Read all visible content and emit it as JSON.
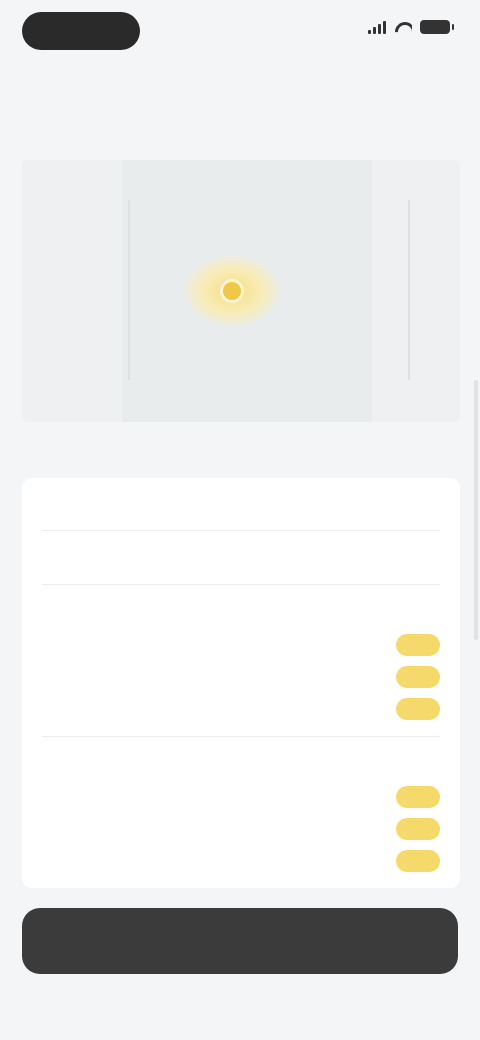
{
  "status_bar": {
    "time": "",
    "signal_icon": "signal-icon",
    "wifi_icon": "wifi-icon",
    "battery_icon": "battery-icon"
  },
  "header": {
    "title": ""
  },
  "section": {
    "title": ""
  },
  "preview": {
    "marker_icon": "location-marker-icon",
    "marker_label": "",
    "accent_color": "#efc84a"
  },
  "list": {
    "rows": [
      {
        "label": "",
        "value": ""
      },
      {
        "label": "",
        "value": ""
      },
      {
        "label": "",
        "value": "",
        "sub_items": [
          {
            "label": "",
            "badge": ""
          },
          {
            "label": "",
            "badge": ""
          },
          {
            "label": "",
            "badge": ""
          }
        ]
      },
      {
        "label": "",
        "value": "",
        "sub_items": [
          {
            "label": "",
            "badge": ""
          },
          {
            "label": "",
            "badge": ""
          },
          {
            "label": "",
            "badge": ""
          }
        ]
      }
    ]
  },
  "action": {
    "label": "",
    "color": "#3a3b3a"
  }
}
